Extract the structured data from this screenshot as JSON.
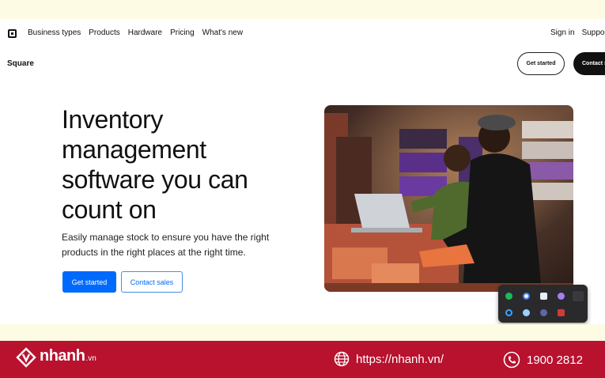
{
  "nav": {
    "links": [
      "Business types",
      "Products",
      "Hardware",
      "Pricing",
      "What's new"
    ],
    "sign_in": "Sign in",
    "support": "Support"
  },
  "subnav": {
    "brand": "Square",
    "get_started": "Get started",
    "contact": "Contact sales"
  },
  "hero": {
    "title": "Inventory management software you can count on",
    "subtitle": "Easily manage stock to ensure you have the right products in the right places at the right time.",
    "primary_button": "Get started",
    "secondary_button": "Contact sales"
  },
  "tray_icons": [
    "spotify-icon",
    "chrome-icon",
    "notes-icon",
    "zoom-icon",
    "feather-icon",
    "sync-icon",
    "edge-icon",
    "teams-icon",
    "shield-icon"
  ],
  "footer": {
    "brand": "nhanh",
    "tld": ".vn",
    "url": "https://nhanh.vn/",
    "phone": "1900 2812"
  },
  "colors": {
    "accent": "#006aff",
    "footer_bg": "#b8122e",
    "strip_bg": "#fdfbe3"
  }
}
